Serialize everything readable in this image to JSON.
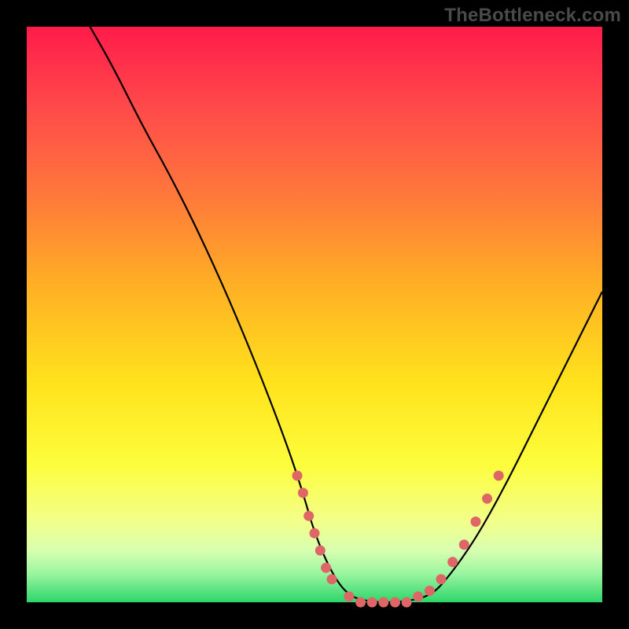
{
  "watermark": "TheBottleneck.com",
  "chart_data": {
    "type": "line",
    "title": "",
    "xlabel": "",
    "ylabel": "",
    "xlim": [
      0,
      100
    ],
    "ylim": [
      0,
      100
    ],
    "grid": false,
    "legend": false,
    "curve": {
      "x": [
        11,
        15,
        20,
        25,
        30,
        35,
        40,
        45,
        48,
        50,
        53,
        56,
        60,
        65,
        70,
        73,
        78,
        83,
        88,
        93,
        98,
        100
      ],
      "y": [
        100,
        93,
        83,
        74,
        64,
        53,
        41,
        28,
        19,
        12,
        5,
        1,
        0,
        0,
        1,
        4,
        11,
        20,
        30,
        40,
        50,
        54
      ]
    },
    "markers": {
      "comment": "salmon dots along the bottom of the V on both flanks and across the trough",
      "points": [
        {
          "x": 47,
          "y": 22
        },
        {
          "x": 48,
          "y": 19
        },
        {
          "x": 49,
          "y": 15
        },
        {
          "x": 50,
          "y": 12
        },
        {
          "x": 51,
          "y": 9
        },
        {
          "x": 52,
          "y": 6
        },
        {
          "x": 53,
          "y": 4
        },
        {
          "x": 56,
          "y": 1
        },
        {
          "x": 58,
          "y": 0
        },
        {
          "x": 60,
          "y": 0
        },
        {
          "x": 62,
          "y": 0
        },
        {
          "x": 64,
          "y": 0
        },
        {
          "x": 66,
          "y": 0
        },
        {
          "x": 68,
          "y": 1
        },
        {
          "x": 70,
          "y": 2
        },
        {
          "x": 72,
          "y": 4
        },
        {
          "x": 74,
          "y": 7
        },
        {
          "x": 76,
          "y": 10
        },
        {
          "x": 78,
          "y": 14
        },
        {
          "x": 80,
          "y": 18
        },
        {
          "x": 82,
          "y": 22
        }
      ]
    },
    "colors": {
      "gradient_top": "#ff1b4a",
      "gradient_mid_orange": "#ff7a3a",
      "gradient_mid_yellow": "#ffe31c",
      "gradient_bottom": "#2dd66a",
      "curve": "#000000",
      "markers": "#de6666",
      "frame": "#000000"
    }
  }
}
